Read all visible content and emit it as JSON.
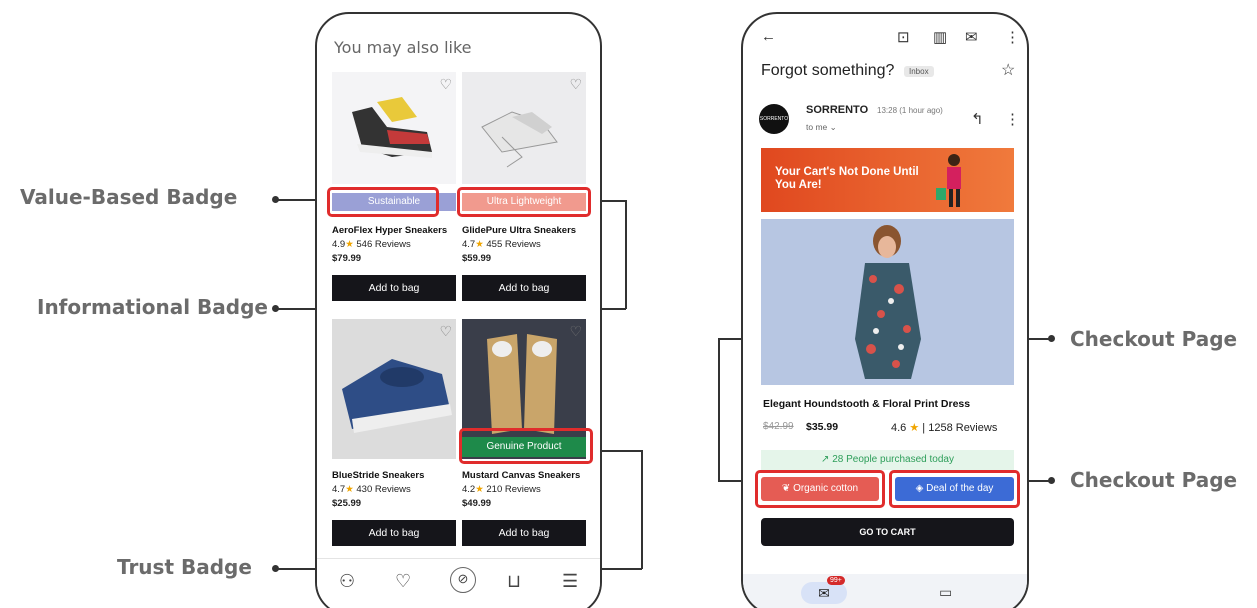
{
  "annotations": {
    "value_badge": "Value-Based Badge",
    "informational_badge": "Informational Badge",
    "trust_badge": "Trust Badge",
    "checkout_top": "Checkout Page",
    "checkout_bottom": "Checkout Page"
  },
  "left_phone": {
    "title": "You may also like",
    "products": [
      {
        "name": "AeroFlex Hyper Sneakers",
        "rating": "4.9",
        "reviews": "546 Reviews",
        "price": "$79.99",
        "badge": "Sustainable",
        "badge_color": "#9aa0d6",
        "button": "Add to bag"
      },
      {
        "name": "GlidePure Ultra Sneakers",
        "rating": "4.7",
        "reviews": "455 Reviews",
        "price": "$59.99",
        "badge": "Ultra Lightweight",
        "badge_color": "#f19a8e",
        "button": "Add to bag"
      },
      {
        "name": "BlueStride Sneakers",
        "rating": "4.7",
        "reviews": "430 Reviews",
        "price": "$25.99",
        "badge": "",
        "button": "Add to bag"
      },
      {
        "name": "Mustard Canvas Sneakers",
        "rating": "4.2",
        "reviews": "210 Reviews",
        "price": "$49.99",
        "badge": "Genuine Product",
        "badge_color": "#1e8a4a",
        "button": "Add to bag"
      }
    ],
    "nav_icons": [
      "user-icon",
      "heart-icon",
      "search-icon",
      "cart-icon",
      "menu-icon"
    ]
  },
  "right_phone": {
    "subject": "Forgot something?",
    "folder_tag": "Inbox",
    "avatar_text": "SORRENTO",
    "sender": "SORRENTO",
    "time": "13:28 (1 hour ago)",
    "to": "to me",
    "banner_text": "Your Cart's Not Done Until You Are!",
    "product_name": "Elegant Houndstooth & Floral Print Dress",
    "old_price": "$42.99",
    "new_price": "$35.99",
    "rating": "4.6",
    "reviews": "1258 Reviews",
    "purchased": "28 People purchased today",
    "pill_left": "Organic cotton",
    "pill_right": "Deal of the day",
    "cart_button": "GO TO CART",
    "mail_badge": "99+"
  }
}
